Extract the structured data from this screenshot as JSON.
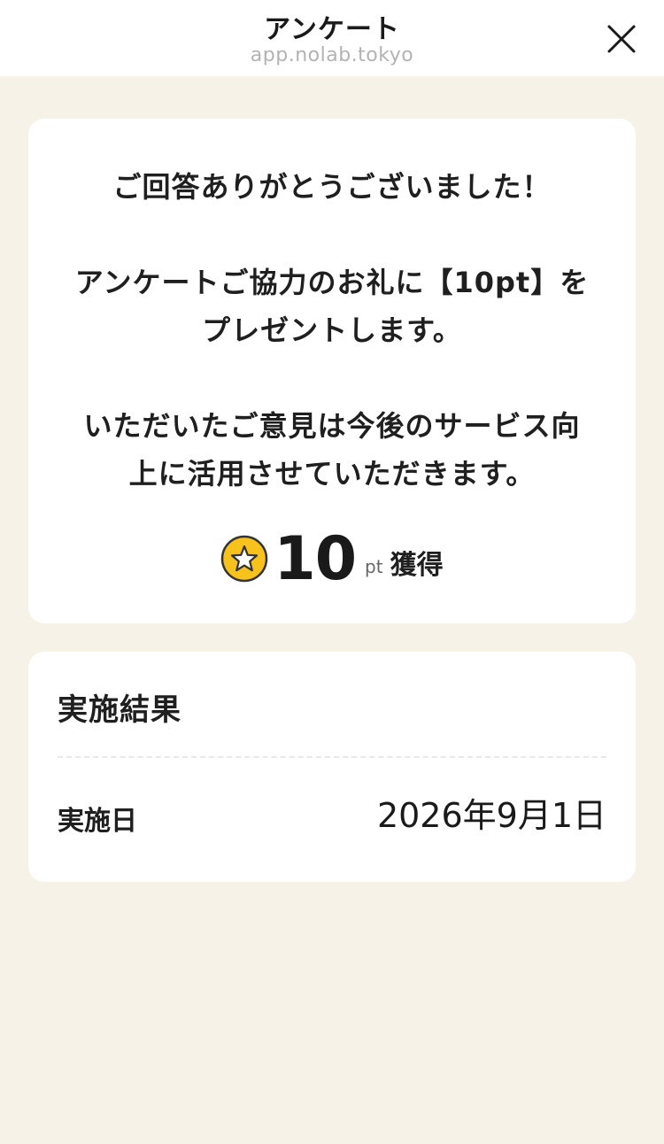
{
  "header": {
    "title": "アンケート",
    "url": "app.nolab.tokyo",
    "close_icon": "close-icon"
  },
  "thanks_card": {
    "line1": "ご回答ありがとうございました！",
    "line2a": "アンケートご協力のお礼に【10pt】を",
    "line2b": "プレゼントします。",
    "line3a": "いただいたご意見は今後のサービス向",
    "line3b": "上に活用させていただきます。",
    "points": {
      "icon": "star-coin-icon",
      "value": "10",
      "unit": "pt",
      "label": "獲得"
    }
  },
  "result_card": {
    "title": "実施結果",
    "rows": [
      {
        "label": "実施日",
        "value": "2026年9月1日"
      }
    ]
  },
  "colors": {
    "background": "#f6f2e8",
    "card": "#ffffff",
    "coin_fill": "#f7c21b",
    "coin_border": "#333333"
  }
}
